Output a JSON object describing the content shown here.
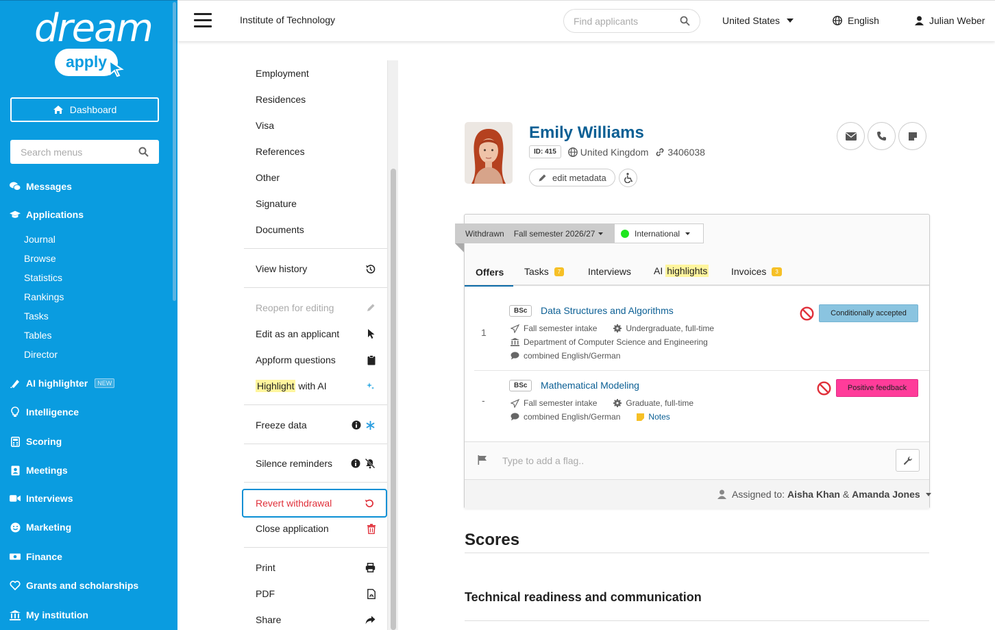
{
  "sidebar": {
    "logo_word": "dream",
    "logo_sub": "apply",
    "dashboard_label": "Dashboard",
    "search_placeholder": "Search menus",
    "items": [
      {
        "label": "Messages",
        "icon": "comments-icon"
      },
      {
        "label": "Applications",
        "icon": "graduation-cap-icon"
      },
      {
        "label": "AI highlighter",
        "icon": "highlighter-icon",
        "badge": "NEW"
      },
      {
        "label": "Intelligence",
        "icon": "lightbulb-icon"
      },
      {
        "label": "Scoring",
        "icon": "calculator-icon"
      },
      {
        "label": "Meetings",
        "icon": "contact-book-icon"
      },
      {
        "label": "Interviews",
        "icon": "video-camera-icon"
      },
      {
        "label": "Marketing",
        "icon": "smile-icon"
      },
      {
        "label": "Finance",
        "icon": "money-bill-icon"
      },
      {
        "label": "Grants and scholarships",
        "icon": "heart-icon"
      },
      {
        "label": "My institution",
        "icon": "institution-icon"
      }
    ],
    "applications_sub": [
      "Journal",
      "Browse",
      "Statistics",
      "Rankings",
      "Tasks",
      "Tables",
      "Director"
    ]
  },
  "header": {
    "institution": "Institute of Technology",
    "search_placeholder": "Find applicants",
    "country": "United States",
    "language": "English",
    "user": "Julian Weber"
  },
  "menu": {
    "items_top": [
      "Employment",
      "Residences",
      "Visa",
      "References",
      "Other",
      "Signature",
      "Documents"
    ],
    "view_history": "View history",
    "reopen": "Reopen for editing",
    "edit_as_applicant": "Edit as an applicant",
    "appform_questions": "Appform questions",
    "highlight_word": "Highlight",
    "highlight_rest": "with AI",
    "freeze": "Freeze data",
    "silence": "Silence reminders",
    "revert": "Revert withdrawal",
    "close": "Close application",
    "print": "Print",
    "pdf": "PDF",
    "share": "Share"
  },
  "applicant": {
    "name": "Emily Williams",
    "id_label": "ID: 415",
    "country": "United Kingdom",
    "link_id": "3406038",
    "edit_metadata": "edit metadata"
  },
  "status": {
    "state": "Withdrawn",
    "semester": "Fall semester 2026/27",
    "group": "International"
  },
  "tabs": {
    "offers": "Offers",
    "tasks": "Tasks",
    "tasks_count": "7",
    "interviews": "Interviews",
    "ai_prefix": "AI",
    "ai_highlight": "highlights",
    "invoices": "Invoices",
    "invoices_count": "3"
  },
  "offers": [
    {
      "num": "1",
      "degree": "BSc",
      "title": "Data Structures and Algorithms",
      "intake": "Fall semester intake",
      "level": "Undergraduate, full-time",
      "department": "Department of Computer Science and Engineering",
      "language": "combined English/German",
      "status": "Conditionally accepted",
      "status_color": "#8ac4e0"
    },
    {
      "num": "-",
      "degree": "BSc",
      "title": "Mathematical Modeling",
      "intake": "Fall semester intake",
      "level": "Graduate, full-time",
      "language": "combined English/German",
      "notes": "Notes",
      "status": "Positive feedback",
      "status_color": "#ff3c9a"
    }
  ],
  "flag_placeholder": "Type to add a flag..",
  "assigned": {
    "label": "Assigned to:",
    "person1": "Aisha Khan",
    "amp": "&",
    "person2": "Amanda Jones"
  },
  "scores_title": "Scores",
  "section_title": "Technical readiness and communication",
  "colors": {
    "sidebar": "#0a9ce0",
    "link": "#0b5f94",
    "danger": "#e0303a",
    "highlight": "#fff59d"
  }
}
